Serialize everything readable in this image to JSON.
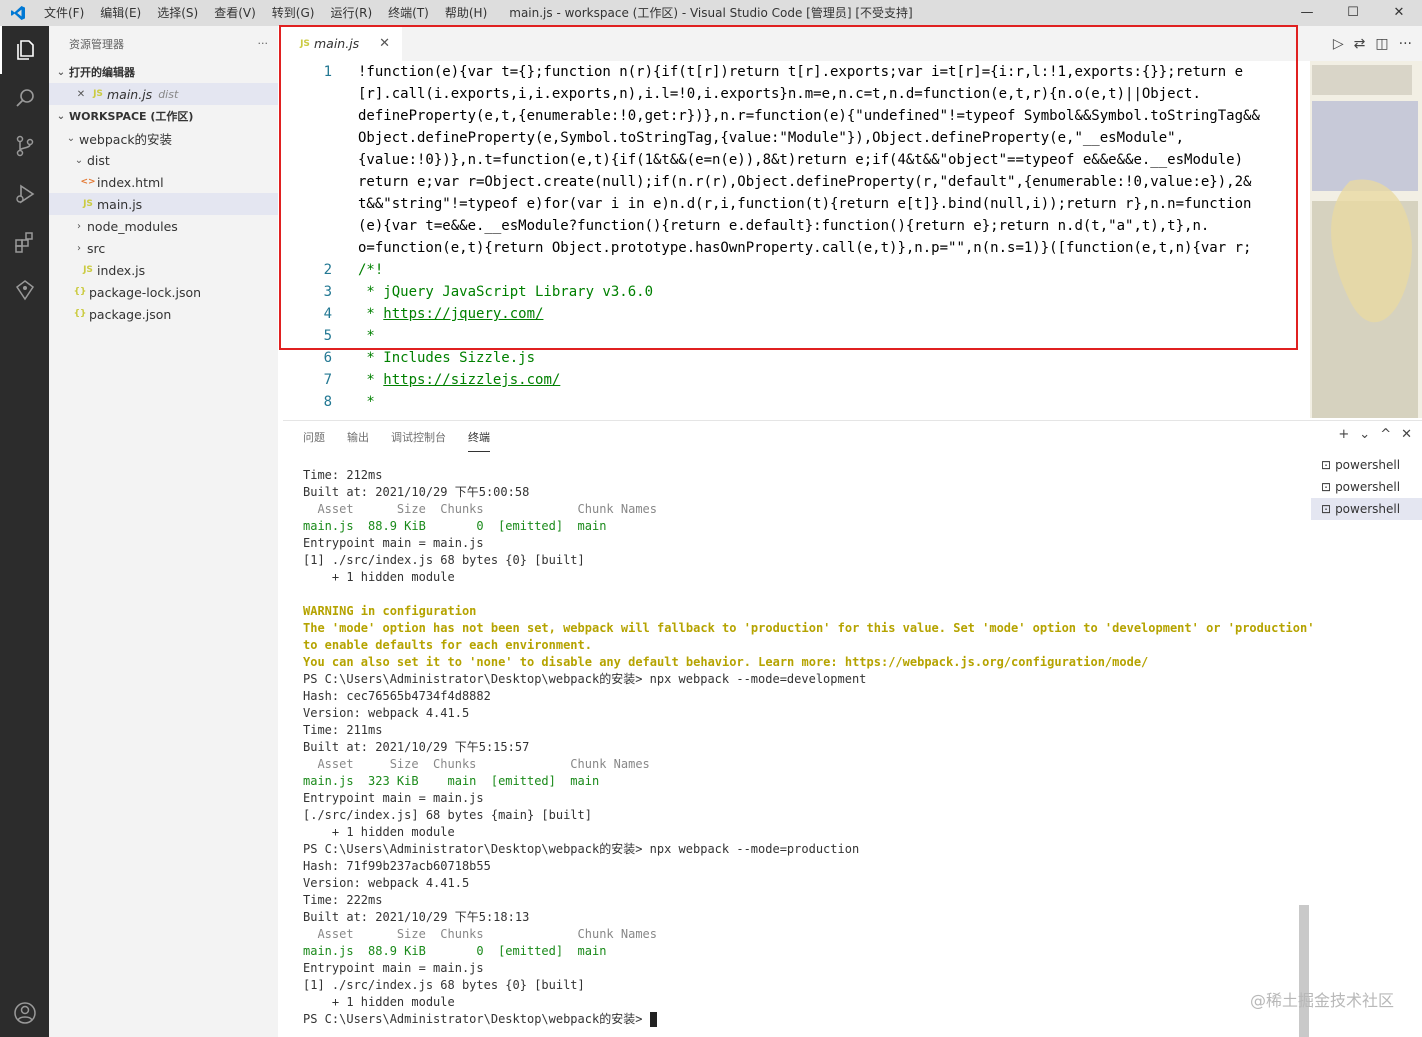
{
  "titlebar": {
    "menu": [
      "文件(F)",
      "编辑(E)",
      "选择(S)",
      "查看(V)",
      "转到(G)",
      "运行(R)",
      "终端(T)",
      "帮助(H)"
    ],
    "title": "main.js - workspace (工作区) - Visual Studio Code [管理员] [不受支持]",
    "minimize": "—",
    "maximize": "☐",
    "close": "✕"
  },
  "sidebar": {
    "header": "资源管理器",
    "more": "···",
    "open_editors_section": "打开的编辑器",
    "open_editor_file": "main.js",
    "open_editor_dir": "dist",
    "workspace_section": "WORKSPACE (工作区)",
    "tree": [
      {
        "label": "webpack的安装",
        "type": "folder",
        "depth": 1
      },
      {
        "label": "dist",
        "type": "folder",
        "depth": 2
      },
      {
        "label": "index.html",
        "type": "html",
        "depth": 3
      },
      {
        "label": "main.js",
        "type": "js",
        "depth": 3,
        "selected": true
      },
      {
        "label": "node_modules",
        "type": "folder-closed",
        "depth": 2
      },
      {
        "label": "src",
        "type": "folder-closed",
        "depth": 2
      },
      {
        "label": "index.js",
        "type": "js",
        "depth": 3
      },
      {
        "label": "package-lock.json",
        "type": "json",
        "depth": 2
      },
      {
        "label": "package.json",
        "type": "json",
        "depth": 2
      }
    ]
  },
  "editor": {
    "tab_label": "main.js",
    "tab_close": "✕",
    "line_numbers": [
      "1",
      "2",
      "3",
      "4",
      "5",
      "6",
      "7",
      "8"
    ],
    "lines": [
      "!function(e){var t={};function n(r){if(t[r])return t[r].exports;var i=t[r]={i:r,l:!1,exports:{}};return e",
      "[r].call(i.exports,i,i.exports,n),i.l=!0,i.exports}n.m=e,n.c=t,n.d=function(e,t,r){n.o(e,t)||Object.",
      "defineProperty(e,t,{enumerable:!0,get:r})},n.r=function(e){\"undefined\"!=typeof Symbol&&Symbol.toStringTag&&",
      "Object.defineProperty(e,Symbol.toStringTag,{value:\"Module\"}),Object.defineProperty(e,\"__esModule\",",
      "{value:!0})},n.t=function(e,t){if(1&t&&(e=n(e)),8&t)return e;if(4&t&&\"object\"==typeof e&&e&&e.__esModule)",
      "return e;var r=Object.create(null);if(n.r(r),Object.defineProperty(r,\"default\",{enumerable:!0,value:e}),2&",
      "t&&\"string\"!=typeof e)for(var i in e)n.d(r,i,function(t){return e[t]}.bind(null,i));return r},n.n=function",
      "(e){var t=e&&e.__esModule?function(){return e.default}:function(){return e};return n.d(t,\"a\",t),t},n.",
      "o=function(e,t){return Object.prototype.hasOwnProperty.call(e,t)},n.p=\"\",n(n.s=1)}([function(e,t,n){var r;",
      "/*!",
      " * jQuery JavaScript Library v3.6.0",
      " * https://jquery.com/",
      " *",
      " * Includes Sizzle.js",
      " * https://sizzlejs.com/",
      " *"
    ]
  },
  "panel": {
    "tabs": [
      "问题",
      "输出",
      "调试控制台",
      "终端"
    ],
    "active_tab": "终端",
    "actions": [
      "+",
      "⌄",
      "^",
      "✕"
    ],
    "terminals": [
      "powershell",
      "powershell",
      "powershell"
    ],
    "terminal_lines": [
      "Time: 212ms",
      "Built at: 2021/10/29 下午5:00:58",
      "  Asset      Size  Chunks             Chunk Names",
      "main.js  88.9 KiB       0  [emitted]  main",
      "Entrypoint main = main.js",
      "[1] ./src/index.js 68 bytes {0} [built]",
      "    + 1 hidden module",
      "",
      "WARNING in configuration",
      "The 'mode' option has not been set, webpack will fallback to 'production' for this value. Set 'mode' option to 'development' or 'production'",
      "to enable defaults for each environment.",
      "You can also set it to 'none' to disable any default behavior. Learn more: https://webpack.js.org/configuration/mode/",
      "PS C:\\Users\\Administrator\\Desktop\\webpack的安装> npx webpack --mode=development",
      "Hash: cec76565b4734f4d8882",
      "Version: webpack 4.41.5",
      "Time: 211ms",
      "Built at: 2021/10/29 下午5:15:57",
      "  Asset     Size  Chunks             Chunk Names",
      "main.js  323 KiB    main  [emitted]  main",
      "Entrypoint main = main.js",
      "[./src/index.js] 68 bytes {main} [built]",
      "    + 1 hidden module",
      "PS C:\\Users\\Administrator\\Desktop\\webpack的安装> npx webpack --mode=production",
      "Hash: 71f99b237acb60718b55",
      "Version: webpack 4.41.5",
      "Time: 222ms",
      "Built at: 2021/10/29 下午5:18:13",
      "  Asset      Size  Chunks             Chunk Names",
      "main.js  88.9 KiB       0  [emitted]  main",
      "Entrypoint main = main.js",
      "[1] ./src/index.js 68 bytes {0} [built]",
      "    + 1 hidden module",
      "PS C:\\Users\\Administrator\\Desktop\\webpack的安装> "
    ]
  },
  "watermark": "@稀土掘金技术社区",
  "colors": {
    "activitybar": "#2c2c2c",
    "sidebar": "#f3f3f3",
    "highlight_box": "#e02020",
    "terminal_green": "#1a9c1a",
    "terminal_yellow": "#b5a300"
  }
}
